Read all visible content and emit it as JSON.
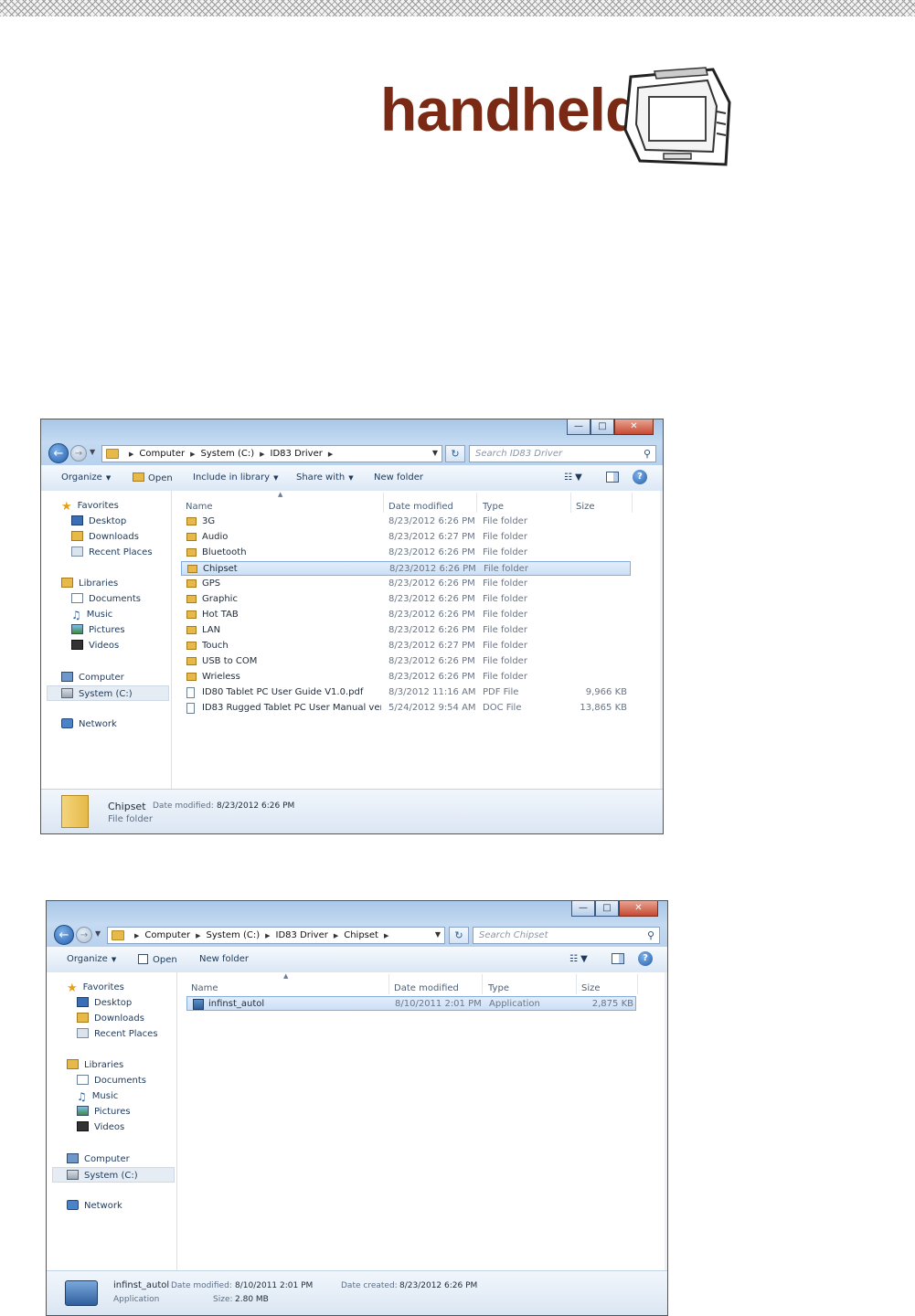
{
  "logo": {
    "text": "handheld"
  },
  "window1": {
    "path": [
      "Computer",
      "System (C:)",
      "ID83 Driver"
    ],
    "search_placeholder": "Search ID83 Driver",
    "toolbar": [
      "Organize",
      "Open",
      "Include in library",
      "Share with",
      "New folder"
    ],
    "nav": {
      "favorites": "Favorites",
      "desktop": "Desktop",
      "downloads": "Downloads",
      "recent": "Recent Places",
      "libraries": "Libraries",
      "documents": "Documents",
      "music": "Music",
      "pictures": "Pictures",
      "videos": "Videos",
      "computer": "Computer",
      "system": "System (C:)",
      "network": "Network"
    },
    "columns": [
      "Name",
      "Date modified",
      "Type",
      "Size"
    ],
    "files": [
      {
        "name": "3G",
        "date": "8/23/2012 6:26 PM",
        "type": "File folder",
        "size": ""
      },
      {
        "name": "Audio",
        "date": "8/23/2012 6:27 PM",
        "type": "File folder",
        "size": ""
      },
      {
        "name": "Bluetooth",
        "date": "8/23/2012 6:26 PM",
        "type": "File folder",
        "size": ""
      },
      {
        "name": "Chipset",
        "date": "8/23/2012 6:26 PM",
        "type": "File folder",
        "size": ""
      },
      {
        "name": "GPS",
        "date": "8/23/2012 6:26 PM",
        "type": "File folder",
        "size": ""
      },
      {
        "name": "Graphic",
        "date": "8/23/2012 6:26 PM",
        "type": "File folder",
        "size": ""
      },
      {
        "name": "Hot TAB",
        "date": "8/23/2012 6:26 PM",
        "type": "File folder",
        "size": ""
      },
      {
        "name": "LAN",
        "date": "8/23/2012 6:26 PM",
        "type": "File folder",
        "size": ""
      },
      {
        "name": "Touch",
        "date": "8/23/2012 6:27 PM",
        "type": "File folder",
        "size": ""
      },
      {
        "name": "USB to COM",
        "date": "8/23/2012 6:26 PM",
        "type": "File folder",
        "size": ""
      },
      {
        "name": "Wrieless",
        "date": "8/23/2012 6:26 PM",
        "type": "File folder",
        "size": ""
      },
      {
        "name": "ID80 Tablet PC User Guide V1.0.pdf",
        "date": "8/3/2012 11:16 AM",
        "type": "PDF File",
        "size": "9,966 KB"
      },
      {
        "name": "ID83 Rugged Tablet PC  User Manual ver...",
        "date": "5/24/2012 9:54 AM",
        "type": "DOC File",
        "size": "13,865 KB"
      }
    ],
    "selected_index": 3,
    "details": {
      "name": "Chipset",
      "modified_label": "Date modified:",
      "modified": "8/23/2012 6:26 PM",
      "type": "File folder"
    }
  },
  "window2": {
    "path": [
      "Computer",
      "System (C:)",
      "ID83 Driver",
      "Chipset"
    ],
    "search_placeholder": "Search Chipset",
    "toolbar": [
      "Organize",
      "Open",
      "New folder"
    ],
    "nav": {
      "favorites": "Favorites",
      "desktop": "Desktop",
      "downloads": "Downloads",
      "recent": "Recent Places",
      "libraries": "Libraries",
      "documents": "Documents",
      "music": "Music",
      "pictures": "Pictures",
      "videos": "Videos",
      "computer": "Computer",
      "system": "System (C:)",
      "network": "Network"
    },
    "columns": [
      "Name",
      "Date modified",
      "Type",
      "Size"
    ],
    "files": [
      {
        "name": "infinst_autol",
        "date": "8/10/2011 2:01 PM",
        "type": "Application",
        "size": "2,875 KB"
      }
    ],
    "details": {
      "name": "infinst_autol",
      "modified_label": "Date modified:",
      "modified": "8/10/2011 2:01 PM",
      "created_label": "Date created:",
      "created": "8/23/2012 6:26 PM",
      "type": "Application",
      "size_label": "Size:",
      "size": "2.80 MB"
    }
  }
}
